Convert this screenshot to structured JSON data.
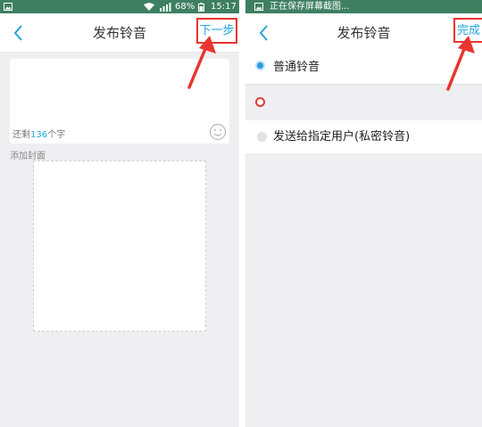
{
  "colors": {
    "status_bar": "#3e7f62",
    "accent": "#21a6d8",
    "highlight_red": "#e8352e",
    "background": "#efeff1"
  },
  "left": {
    "status_bar": {
      "icons": [
        "image-notification-icon",
        "wifi-icon",
        "signal-icon"
      ],
      "battery": "68%",
      "time": "15:17"
    },
    "header": {
      "back_icon": "chevron-left-icon",
      "title": "发布铃音",
      "next_label": "下一步"
    },
    "textarea": {
      "counter_prefix": "还剩",
      "counter_value": "136",
      "counter_suffix": "个字",
      "emoji_icon": "smiley-icon"
    },
    "cover": {
      "label": "添加封面"
    }
  },
  "right": {
    "status_bar": {
      "icon": "image-notification-icon",
      "text": "正在保存屏幕截图..."
    },
    "header": {
      "back_icon": "chevron-left-icon",
      "title": "发布铃音",
      "done_label": "完成"
    },
    "options": [
      {
        "label": "普通铃音",
        "selected": true
      },
      {
        "label": "",
        "selected": false
      },
      {
        "label": "发送给指定用户(私密铃音)",
        "selected": false
      }
    ]
  }
}
